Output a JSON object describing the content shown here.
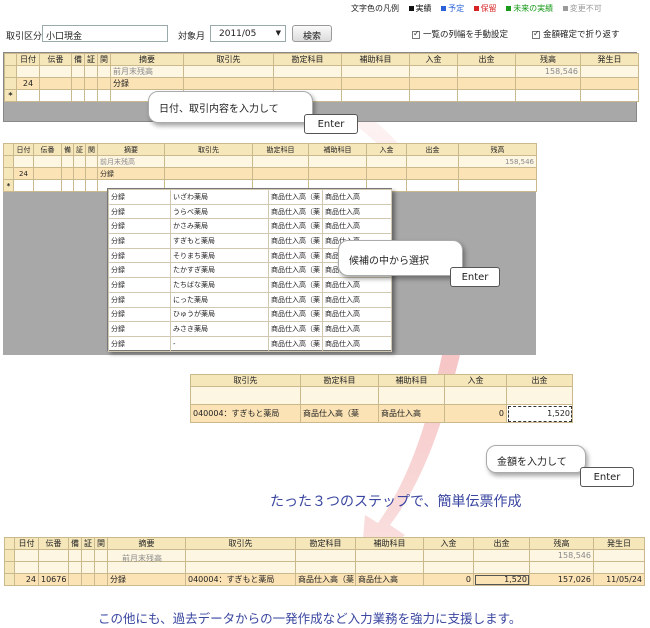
{
  "legend": {
    "title": "文字色の凡例",
    "items": [
      {
        "label": "実績",
        "color": "#111111"
      },
      {
        "label": "予定",
        "color": "#2b62d9"
      },
      {
        "label": "保留",
        "color": "#d62424"
      },
      {
        "label": "未来の実績",
        "color": "#1a9a1a"
      },
      {
        "label": "変更不可",
        "color": "#9a9a9a"
      }
    ]
  },
  "toolbar": {
    "category_label": "取引区分",
    "category_value": "小口現金",
    "month_label": "対象月",
    "month_value": "2011/05",
    "search_label": "検索",
    "manual_cols_label": "一覧の列幅を手動設定",
    "wrap_label": "金額確定で折り返す"
  },
  "grid1": {
    "headers": [
      "日付",
      "伝番",
      "備",
      "証",
      "関",
      "摘要",
      "取引先",
      "勘定科目",
      "補助科目",
      "入金",
      "出金",
      "残高",
      "発生日"
    ],
    "carry": {
      "label": "前月末残高",
      "balance": "158,546"
    },
    "row": {
      "day": "24",
      "summary": "分録"
    },
    "new_marker": "*"
  },
  "callout1": {
    "text": "日付、取引内容を入力して",
    "key": "Enter"
  },
  "grid2": {
    "headers": [
      "日付",
      "伝番",
      "備",
      "証",
      "関",
      "摘要",
      "取引先",
      "勘定科目",
      "補助科目",
      "入金",
      "出金",
      "残高"
    ],
    "carry": {
      "label": "前月末残高",
      "balance": "158,546"
    },
    "row": {
      "day": "24",
      "summary": "分録"
    },
    "new_marker": "*",
    "dropdown": [
      {
        "summary": "分録",
        "partner": "いざわ薬局",
        "account": "商品仕入高（薬",
        "sub": "商品仕入高"
      },
      {
        "summary": "分録",
        "partner": "うらべ薬局",
        "account": "商品仕入高（薬",
        "sub": "商品仕入高"
      },
      {
        "summary": "分録",
        "partner": "かさみ薬局",
        "account": "商品仕入高（薬",
        "sub": "商品仕入高"
      },
      {
        "summary": "分録",
        "partner": "すぎもと薬局",
        "account": "商品仕入高（薬",
        "sub": "商品仕入高"
      },
      {
        "summary": "分録",
        "partner": "そりまち薬局",
        "account": "商品仕入高（薬",
        "sub": "商品仕入高"
      },
      {
        "summary": "分録",
        "partner": "たかすぎ薬局",
        "account": "商品仕入高（薬",
        "sub": "商品仕入高"
      },
      {
        "summary": "分録",
        "partner": "たちばな薬局",
        "account": "商品仕入高（薬",
        "sub": "商品仕入高"
      },
      {
        "summary": "分録",
        "partner": "にった薬局",
        "account": "商品仕入高（薬",
        "sub": "商品仕入高"
      },
      {
        "summary": "分録",
        "partner": "ひゅうが薬局",
        "account": "商品仕入高（薬",
        "sub": "商品仕入高"
      },
      {
        "summary": "分録",
        "partner": "みさき薬局",
        "account": "商品仕入高（薬",
        "sub": "商品仕入高"
      },
      {
        "summary": "分録",
        "partner": "-",
        "account": "商品仕入高（薬",
        "sub": "商品仕入高"
      }
    ]
  },
  "callout2": {
    "text": "候補の中から選択",
    "key": "Enter"
  },
  "grid3": {
    "headers": [
      "取引先",
      "勘定科目",
      "補助科目",
      "入金",
      "出金"
    ],
    "row": {
      "partner": "040004：すぎもと薬局",
      "account": "商品仕入高（薬",
      "sub": "商品仕入高",
      "in": "0",
      "out": "1,520"
    }
  },
  "callout3": {
    "text": "金額を入力して",
    "key": "Enter"
  },
  "headline": "たった３つのステップで、簡単伝票作成",
  "grid4": {
    "headers": [
      "日付",
      "伝番",
      "備",
      "証",
      "関",
      "摘要",
      "取引先",
      "勘定科目",
      "補助科目",
      "入金",
      "出金",
      "残高",
      "発生日"
    ],
    "carry": {
      "label": "前月末残高",
      "balance": "158,546"
    },
    "row": {
      "day": "24",
      "no": "10676",
      "summary": "分録",
      "partner": "040004：すぎもと薬局",
      "account": "商品仕入高（薬",
      "sub": "商品仕入高",
      "in": "0",
      "out": "1,520",
      "balance": "157,026",
      "date": "11/05/24"
    }
  },
  "footer": "この他にも、過去データからの一発作成など入力業務を強力に支援します。"
}
